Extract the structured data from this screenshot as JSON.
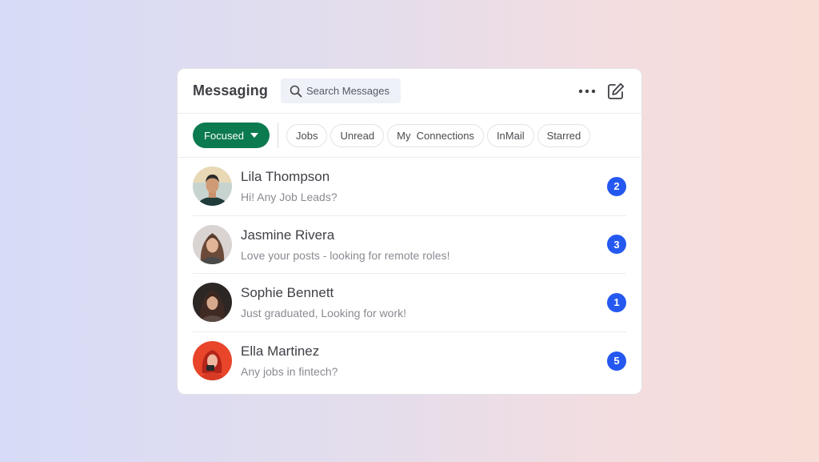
{
  "header": {
    "title": "Messaging",
    "search_placeholder": "Search Messages",
    "more_icon": "more-horizontal-icon",
    "compose_icon": "compose-edit-icon"
  },
  "filters": {
    "primary": "Focused",
    "chips": [
      "Jobs",
      "Unread",
      "My  Connections",
      "InMail",
      "Starred"
    ]
  },
  "conversations": [
    {
      "name": "Lila Thompson",
      "preview": "Hi! Any Job Leads?",
      "unread": "2"
    },
    {
      "name": "Jasmine Rivera",
      "preview": "Love your posts - looking for remote roles!",
      "unread": "3"
    },
    {
      "name": "Sophie Bennett",
      "preview": "Just graduated, Looking for work!",
      "unread": "1"
    },
    {
      "name": "Ella Martinez",
      "preview": "Any jobs in fintech?",
      "unread": "5"
    }
  ],
  "colors": {
    "accent_green": "#0c7a4f",
    "badge_blue": "#2458f0"
  }
}
